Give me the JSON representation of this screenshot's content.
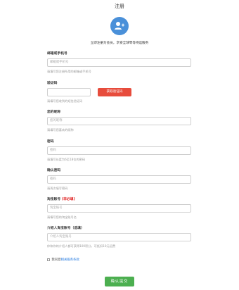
{
  "header": {
    "title": "注册"
  },
  "intro": {
    "text": "立即注册为会员，享受全球零等待运服务"
  },
  "fields": {
    "email": {
      "label": "邮箱或手机号",
      "placeholder": "邮箱或手机号",
      "hint": "请填写您注册所用的邮箱或手机号"
    },
    "code": {
      "label": "验证码",
      "button": "获取验证码",
      "hint": "请填写您收到的短信验证码"
    },
    "nickname": {
      "label": "您的昵称",
      "placeholder": "您的昵称",
      "hint": "请填写您喜欢的昵称"
    },
    "password": {
      "label": "密码",
      "placeholder": "密码",
      "hint": "请填写长度为6至18位的密码"
    },
    "confirm": {
      "label": "确认密码",
      "placeholder": "密码",
      "hint": "请再次填写密码"
    },
    "taobao": {
      "label": "淘宝账号",
      "required": "(非必填)",
      "placeholder": "淘宝账号",
      "hint": "请填写您的淘宝账号名"
    },
    "referrer": {
      "label": "介绍人淘宝账号（选填）",
      "placeholder": "介绍人淘宝账号",
      "hint": "你和你的介绍人都可获得100积分，可抵扣10元运费"
    }
  },
  "agreement": {
    "prefix": "我同意",
    "link": "相关服务条款"
  },
  "submit": {
    "label": "确认提交"
  },
  "colors": {
    "accent": "#4a90d9",
    "danger": "#e74c3c",
    "success": "#4caf50"
  }
}
